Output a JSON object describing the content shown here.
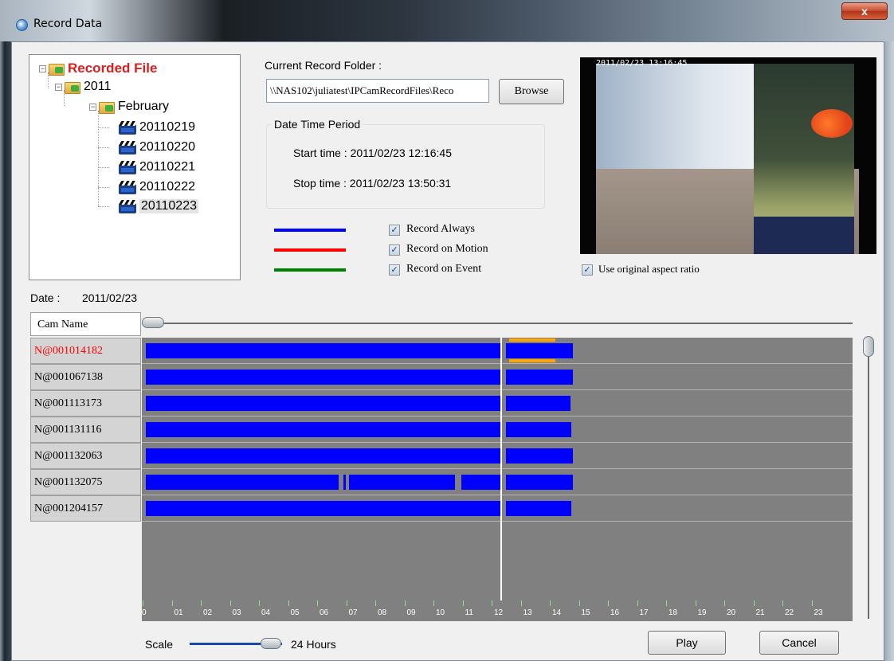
{
  "window": {
    "title": "Record Data",
    "close_glyph": "x"
  },
  "tree": {
    "root": "Recorded File",
    "year": "2011",
    "month": "February",
    "days": [
      "20110219",
      "20110220",
      "20110221",
      "20110222",
      "20110223"
    ],
    "selected": "20110223"
  },
  "record_folder": {
    "label": "Current Record Folder :",
    "value": "\\\\NAS102\\juliatest\\IPCamRecordFiles\\Reco",
    "browse_label": "Browse"
  },
  "period": {
    "title": "Date Time Period",
    "start": "Start time : 2011/02/23 12:16:45",
    "stop": "Stop time : 2011/02/23 13:50:31"
  },
  "legend": [
    {
      "label": "Record Always",
      "color": "#0000ff",
      "checked": true
    },
    {
      "label": "Record on Motion",
      "color": "#ff0000",
      "checked": true
    },
    {
      "label": "Record on Event",
      "color": "#008000",
      "checked": true
    }
  ],
  "video": {
    "osd": "2011/02/23 13:16:45",
    "aspect_label": "Use original aspect ratio",
    "aspect_checked": true
  },
  "date": {
    "label": "Date :",
    "value": "2011/02/23"
  },
  "timeline": {
    "cam_header": "Cam Name",
    "hours": [
      "0",
      "01",
      "02",
      "03",
      "04",
      "05",
      "06",
      "07",
      "08",
      "09",
      "10",
      "11",
      "12",
      "13",
      "14",
      "15",
      "16",
      "17",
      "18",
      "19",
      "20",
      "21",
      "22",
      "23"
    ],
    "cameras": [
      {
        "name": "N@001014182",
        "highlight": true,
        "color": "#ff0000",
        "segments": [
          [
            0.1,
            12.3
          ],
          [
            12.5,
            14.8
          ]
        ],
        "motion": [
          [
            12.6,
            14.2
          ]
        ]
      },
      {
        "name": "N@001067138",
        "segments": [
          [
            0.1,
            12.3
          ],
          [
            12.5,
            14.8
          ]
        ]
      },
      {
        "name": "N@001113173",
        "segments": [
          [
            0.1,
            12.3
          ],
          [
            12.5,
            14.7
          ]
        ]
      },
      {
        "name": "N@001131116",
        "segments": [
          [
            0.1,
            12.3
          ],
          [
            12.5,
            14.75
          ]
        ]
      },
      {
        "name": "N@001132063",
        "segments": [
          [
            0.1,
            12.3
          ],
          [
            12.5,
            14.8
          ]
        ]
      },
      {
        "name": "N@001132075",
        "segments": [
          [
            0.1,
            6.75
          ],
          [
            6.9,
            7.0
          ],
          [
            7.1,
            10.75
          ],
          [
            10.95,
            12.3
          ],
          [
            12.5,
            14.8
          ]
        ]
      },
      {
        "name": "N@001204157",
        "segments": [
          [
            0.1,
            12.3
          ],
          [
            12.5,
            14.75
          ]
        ]
      }
    ],
    "cursor_hour": 12.3
  },
  "scale": {
    "label": "Scale",
    "value": "24 Hours"
  },
  "buttons": {
    "play": "Play",
    "cancel": "Cancel"
  }
}
